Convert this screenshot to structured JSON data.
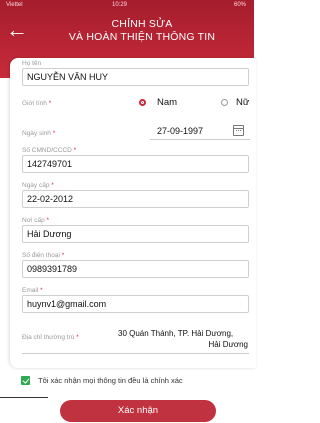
{
  "status": {
    "carrier": "Viettel",
    "time": "10:29",
    "battery": "60%"
  },
  "header": {
    "title_line1": "CHỈNH SỬA",
    "title_line2": "VÀ HOÀN THIỆN THÔNG TIN"
  },
  "form": {
    "name": {
      "label": "Họ tên",
      "value": "NGUYỄN VĂN HUY"
    },
    "gender": {
      "label": "Giới tính",
      "required": "*",
      "option_male": "Nam",
      "option_female": "Nữ",
      "selected": "Nam"
    },
    "dob": {
      "label": "Ngày sinh",
      "required": "*",
      "value": "27-09-1997"
    },
    "id_number": {
      "label": "Số CMND/CCCD",
      "required": "*",
      "value": "142749701"
    },
    "issue_date": {
      "label": "Ngày cấp",
      "required": "*",
      "value": "22-02-2012"
    },
    "issue_place": {
      "label": "Nơi cấp",
      "required": "*",
      "value": "Hải Dương"
    },
    "phone": {
      "label": "Số điện thoại",
      "required": "*",
      "value": "0989391789"
    },
    "email": {
      "label": "Email",
      "required": "*",
      "value": "huynv1@gmail.com"
    },
    "address": {
      "label": "Địa chỉ thường trú",
      "required": "*",
      "value_line1": "30 Quán Thánh, TP. Hải Dương,",
      "value_line2": "Hải Dương"
    }
  },
  "confirm_checkbox": {
    "label": "Tôi xác nhận mọi thông tin đều là chính xác",
    "checked": true
  },
  "submit_button": {
    "label": "Xác nhận"
  },
  "colors": {
    "brand": "#c0323f",
    "check": "#2fa84f"
  }
}
